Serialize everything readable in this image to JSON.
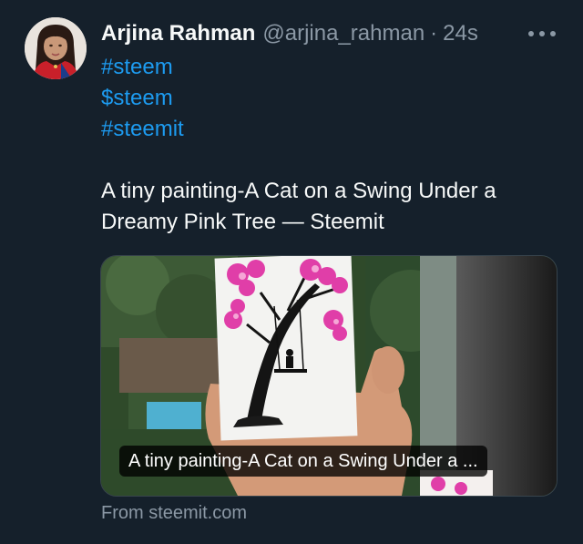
{
  "tweet": {
    "author": {
      "display_name": "Arjina Rahman",
      "handle": "@arjina_rahman",
      "separator": "·",
      "time": "24s"
    },
    "hashtags": [
      "#steem",
      "$steem",
      "#steemit"
    ],
    "text": "A tiny painting-A Cat on a Swing Under a Dreamy Pink Tree — Steemit",
    "card": {
      "title": "A tiny painting-A Cat on a Swing Under a ...",
      "source": "From steemit.com"
    }
  },
  "icons": {
    "more": "more-horizontal-icon"
  },
  "colors": {
    "background": "#15202b",
    "text": "#f7f9f9",
    "secondary_text": "#8b98a5",
    "link": "#1d9bf0",
    "border": "#38444d"
  }
}
